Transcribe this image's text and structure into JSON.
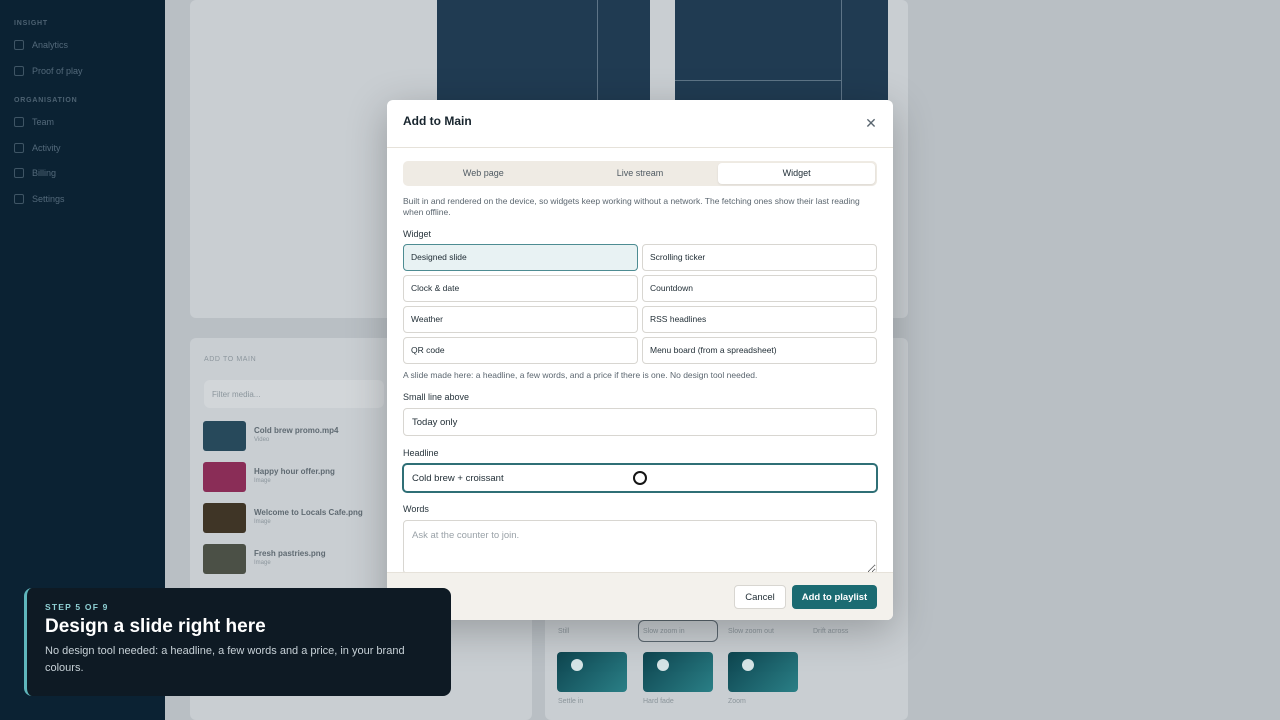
{
  "background": {
    "sidebar": {
      "sections": [
        {
          "title": "Insight",
          "items": [
            "Analytics",
            "Proof of play"
          ]
        },
        {
          "title": "Organisation",
          "items": [
            "Team",
            "Activity",
            "Billing",
            "Settings"
          ]
        }
      ]
    },
    "media_panel": {
      "heading": "Add to Main",
      "search_placeholder": "Filter media...",
      "items": [
        {
          "name": "Cold brew promo.mp4",
          "meta": "Video"
        },
        {
          "name": "Happy hour offer.png",
          "meta": "Image"
        },
        {
          "name": "Welcome to Locals Cafe.png",
          "meta": "Image"
        },
        {
          "name": "Fresh pastries.png",
          "meta": "Image"
        }
      ]
    },
    "tiles": {
      "row1_labels": [
        "Still",
        "Slow zoom in",
        "Slow zoom out",
        "Drift across"
      ],
      "row2_labels": [
        "Settle in",
        "Hard fade",
        "Zoom"
      ]
    }
  },
  "modal": {
    "title": "Add to Main",
    "close_icon": "close-icon",
    "tabs": [
      {
        "label": "Web page",
        "active": false
      },
      {
        "label": "Live stream",
        "active": false
      },
      {
        "label": "Widget",
        "active": true
      }
    ],
    "description": "Built in and rendered on the device, so widgets keep working without a network. The fetching ones show their last reading when offline.",
    "widget_label": "Widget",
    "widgets": [
      {
        "label": "Designed slide",
        "selected": true
      },
      {
        "label": "Scrolling ticker",
        "selected": false
      },
      {
        "label": "Clock & date",
        "selected": false
      },
      {
        "label": "Countdown",
        "selected": false
      },
      {
        "label": "Weather",
        "selected": false
      },
      {
        "label": "RSS headlines",
        "selected": false
      },
      {
        "label": "QR code",
        "selected": false
      },
      {
        "label": "Menu board (from a spreadsheet)",
        "selected": false
      }
    ],
    "hint": "A slide made here: a headline, a few words, and a price if there is one. No design tool needed.",
    "small_line": {
      "label": "Small line above",
      "value": "Today only"
    },
    "headline": {
      "label": "Headline",
      "value": "Cold brew + croissant"
    },
    "words": {
      "label": "Words",
      "placeholder": "Ask at the counter to join."
    },
    "cancel_label": "Cancel",
    "add_label": "Add to playlist",
    "accent_color": "#1b6b72"
  },
  "tour": {
    "step": "STEP 5 OF 9",
    "title": "Design a slide right here",
    "body": "No design tool needed: a headline, a few words and a price, in your brand colours."
  }
}
